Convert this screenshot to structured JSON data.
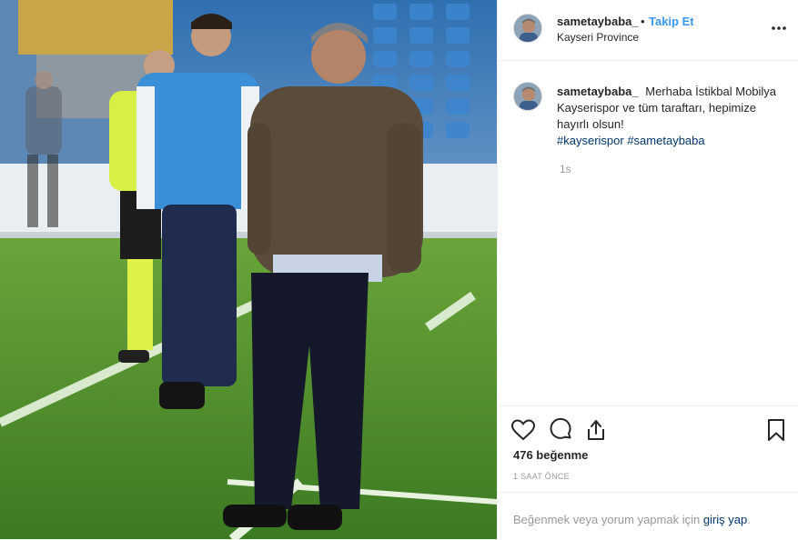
{
  "header": {
    "username": "sametaybaba_",
    "separator": "•",
    "follow_label": "Takip Et",
    "location": "Kayseri Province",
    "more_icon": "more-horizontal-icon"
  },
  "photo": {
    "alt": "Man in brown sweater standing on football pitch sideline"
  },
  "caption": {
    "username": "sametaybaba_",
    "text": "Merhaba İstikbal Mobilya Kayserispor ve tüm taraftarı, hepimize hayırlı olsun!",
    "hashtags": [
      "#kayserispor",
      "#sametaybaba"
    ],
    "time": "1s"
  },
  "actions": {
    "like_icon": "heart-icon",
    "comment_icon": "comment-icon",
    "share_icon": "share-icon",
    "save_icon": "bookmark-icon",
    "likes": "476 beğenme",
    "posted": "1 SAAT ÖNCE"
  },
  "login": {
    "prefix": "Beğenmek veya yorum yapmak için ",
    "link": "giriş yap",
    "suffix": "."
  }
}
